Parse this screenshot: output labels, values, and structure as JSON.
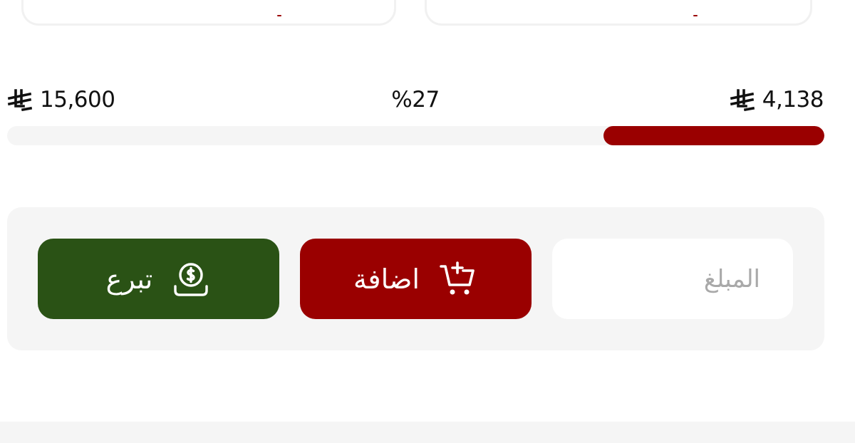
{
  "goal": {
    "amount": "15,600",
    "currency_icon": "riyal-icon"
  },
  "raised": {
    "amount": "4,138",
    "currency_icon": "riyal-icon"
  },
  "progress": {
    "label": "%27",
    "percent": 27,
    "fill_color": "#9a0000",
    "track_color": "#f5f5f5"
  },
  "donation_form": {
    "amount_placeholder": "المبلغ",
    "add_button": {
      "label": "اضافة",
      "icon": "cart-plus-icon",
      "color": "#9a0000"
    },
    "donate_button": {
      "label": "تبرع",
      "icon": "hand-coin-icon",
      "color": "#2a5215"
    }
  }
}
